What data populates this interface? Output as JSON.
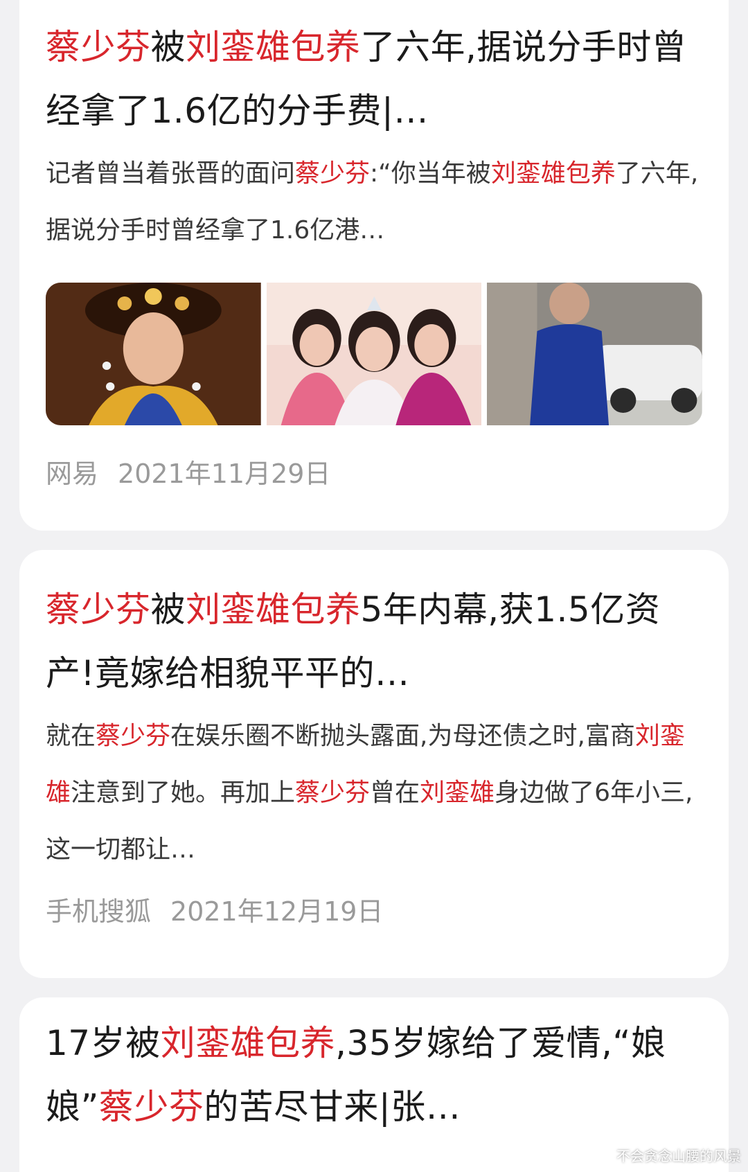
{
  "results": [
    {
      "title": [
        {
          "t": "蔡少芬",
          "hl": true
        },
        {
          "t": "被",
          "hl": false
        },
        {
          "t": "刘銮雄包养",
          "hl": true
        },
        {
          "t": "了六年,据说分手时曾经拿了1.6亿的分手费|…",
          "hl": false
        }
      ],
      "snippet": [
        {
          "t": "记者曾当着张晋的面问",
          "hl": false
        },
        {
          "t": "蔡少芬",
          "hl": true
        },
        {
          "t": ":“你当年被",
          "hl": false
        },
        {
          "t": "刘銮雄包养",
          "hl": true
        },
        {
          "t": "了六年,据说分手时曾经拿了1.6亿港…",
          "hl": false
        }
      ],
      "images": [
        "qing-dynasty-costume-photo",
        "pageant-winners-photo",
        "man-walking-by-car-photo"
      ],
      "source": "网易",
      "date": "2021年11月29日"
    },
    {
      "title": [
        {
          "t": "蔡少芬",
          "hl": true
        },
        {
          "t": "被",
          "hl": false
        },
        {
          "t": "刘銮雄包养",
          "hl": true
        },
        {
          "t": "5年内幕,获1.5亿资产!竟嫁给相貌平平的…",
          "hl": false
        }
      ],
      "snippet": [
        {
          "t": "就在",
          "hl": false
        },
        {
          "t": "蔡少芬",
          "hl": true
        },
        {
          "t": "在娱乐圈不断抛头露面,为母还债之时,富商",
          "hl": false
        },
        {
          "t": "刘銮雄",
          "hl": true
        },
        {
          "t": "注意到了她。再加上",
          "hl": false
        },
        {
          "t": "蔡少芬",
          "hl": true
        },
        {
          "t": "曾在",
          "hl": false
        },
        {
          "t": "刘銮雄",
          "hl": true
        },
        {
          "t": "身边做了6年小三,这一切都让…",
          "hl": false
        }
      ],
      "source": "手机搜狐",
      "date": "2021年12月19日"
    },
    {
      "title": [
        {
          "t": "17岁被",
          "hl": false
        },
        {
          "t": "刘銮雄包养",
          "hl": true
        },
        {
          "t": ",35岁嫁给了爱情,“娘娘”",
          "hl": false
        },
        {
          "t": "蔡少芬",
          "hl": true
        },
        {
          "t": "的苦尽甘来|张…",
          "hl": false
        }
      ]
    }
  ],
  "watermark": "不会贪念山腰的风景",
  "colors": {
    "highlight": "#d8262c",
    "text": "#1b1b1b",
    "meta": "#9a9a9a",
    "background": "#f1f1f3"
  }
}
